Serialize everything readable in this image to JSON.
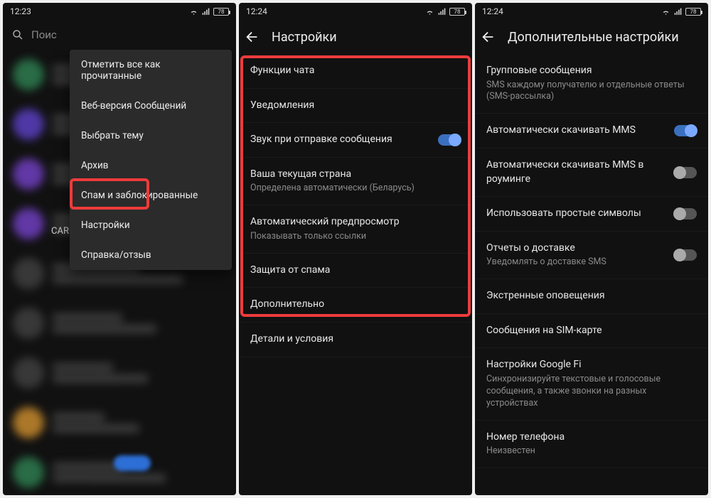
{
  "s1": {
    "time": "12:23",
    "batt": "78",
    "search_placeholder": "Поис",
    "menu": {
      "m0": "Отметить все как прочитанные",
      "m1": "Веб-версия Сообщений",
      "m2": "Выбрать тему",
      "m3": "Архив",
      "m4": "Спам и заблокированные",
      "m5": "Настройки",
      "m6": "Справка/отзыв"
    },
    "visible_word": "CAR"
  },
  "s2": {
    "time": "12:24",
    "batt": "78",
    "title": "Настройки",
    "r0": "Функции чата",
    "r1": "Уведомления",
    "r2": "Звук при отправке сообщения",
    "r3": "Ваша текущая страна",
    "r3s": "Определена автоматически (Беларусь)",
    "r4": "Автоматический предпросмотр",
    "r4s": "Показывать только ссылки",
    "r5": "Защита от спама",
    "r6": "Дополнительно",
    "r7": "Детали и условия"
  },
  "s3": {
    "time": "12:24",
    "batt": "78",
    "title": "Дополнительные настройки",
    "r0": "Групповые сообщения",
    "r0s": "SMS каждому получателю и отдельные ответы (SMS-рассылка)",
    "r1": "Автоматически скачивать MMS",
    "r2": "Автоматически скачивать MMS в роуминге",
    "r3": "Использовать простые символы",
    "r4": "Отчеты о доставке",
    "r4s": "Уведомлять о доставке SMS",
    "r5": "Экстренные оповещения",
    "r6": "Сообщения на SIM-карте",
    "r7": "Настройки Google Fi",
    "r7s": "Синхронизируйте текстовые и голосовые сообщения, а также звонки на разных устройствах",
    "r8": "Номер телефона",
    "r8s": "Неизвестен"
  }
}
